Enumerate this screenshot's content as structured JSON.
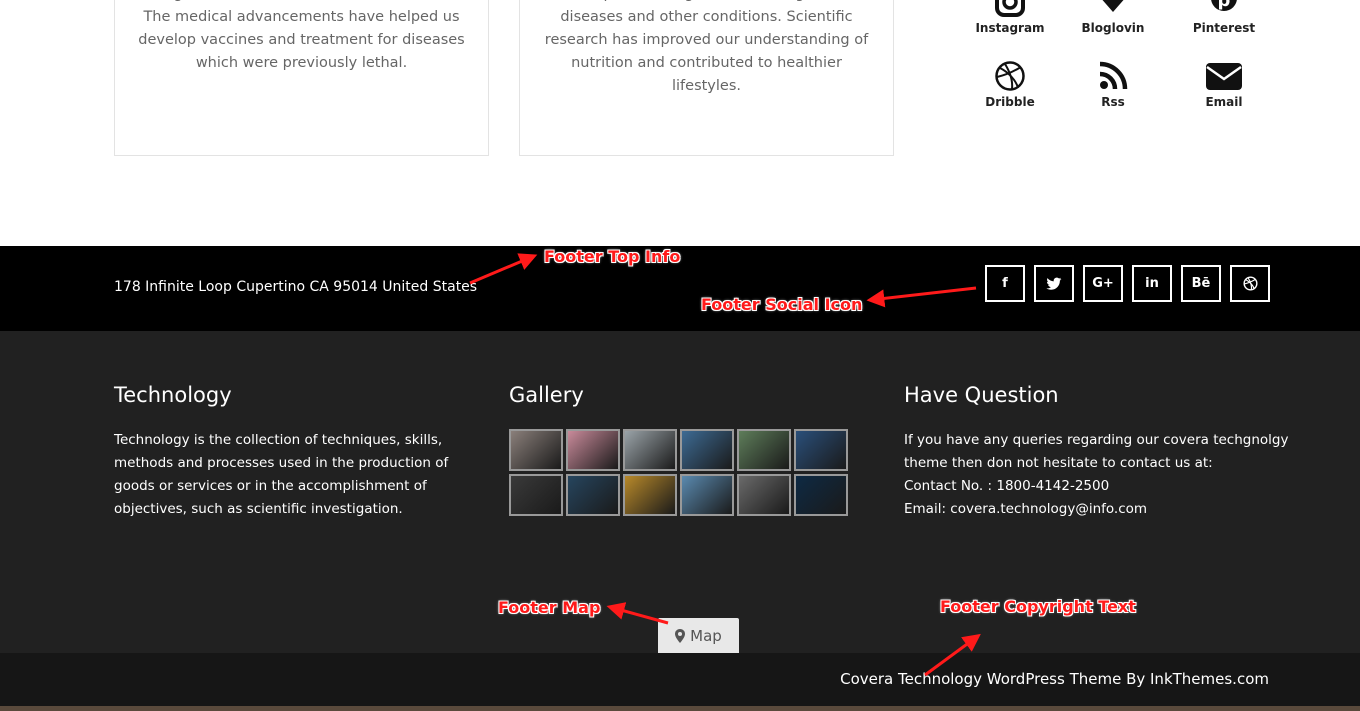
{
  "cards": [
    {
      "text": "longer and much more comfortable lives. The medical advancements have helped us develop vaccines and treatment for diseases which were previously lethal."
    },
    {
      "text": "techniques for diagnosis and mitigation of diseases and other conditions. Scientific research has improved our understanding of nutrition and contributed to healthier lifestyles."
    }
  ],
  "social_grid": [
    {
      "label": "Instagram",
      "icon": "instagram-icon"
    },
    {
      "label": "Bloglovin",
      "icon": "bloglovin-icon"
    },
    {
      "label": "Pinterest",
      "icon": "pinterest-icon"
    },
    {
      "label": "Dribble",
      "icon": "dribbble-icon"
    },
    {
      "label": "Rss",
      "icon": "rss-icon"
    },
    {
      "label": "Email",
      "icon": "email-icon"
    }
  ],
  "footer_top": {
    "address": "178 Infinite Loop Cupertino CA 95014 United States",
    "social": [
      {
        "glyph": "f",
        "icon": "facebook-icon"
      },
      {
        "glyph": "🐦",
        "icon": "twitter-icon"
      },
      {
        "glyph": "G+",
        "icon": "google-plus-icon"
      },
      {
        "glyph": "in",
        "icon": "linkedin-icon"
      },
      {
        "glyph": "Bē",
        "icon": "behance-icon"
      },
      {
        "glyph": "⊛",
        "icon": "dribbble-icon"
      }
    ]
  },
  "footer_main": {
    "technology": {
      "title": "Technology",
      "text": "Technology is the collection of techniques, skills, methods and processes used in the production of goods or services or in the accomplishment of objectives, such as scientific investigation."
    },
    "gallery": {
      "title": "Gallery",
      "thumb_colors": [
        "#8a7f7a",
        "#c98a9a",
        "#9aa3a8",
        "#3d6b94",
        "#5e7d5a",
        "#2a4f7a",
        "#3a3a3a",
        "#26455e",
        "#b8892a",
        "#5a8ab0",
        "#6a6a6a",
        "#0e2a44"
      ]
    },
    "question": {
      "title": "Have Question",
      "line1": "If you have any queries regarding our covera techgnolgy theme then don not hesitate to contact us at:",
      "line2": "Contact No. : 1800-4142-2500",
      "line3": "Email: covera.technology@info.com"
    },
    "map_label": "Map"
  },
  "copyright": "Covera Technology WordPress Theme By InkThemes.com",
  "annotations": {
    "footer_top_info": "Footer Top Info",
    "footer_social_icon": "Footer Social Icon",
    "footer_map": "Footer Map",
    "footer_copyright": "Footer Copyright Text"
  },
  "colors": {
    "annotation": "#ff1a1a",
    "footer_top_bg": "#000000",
    "footer_main_bg": "#212121",
    "footer_bottom_bg": "#161616"
  }
}
